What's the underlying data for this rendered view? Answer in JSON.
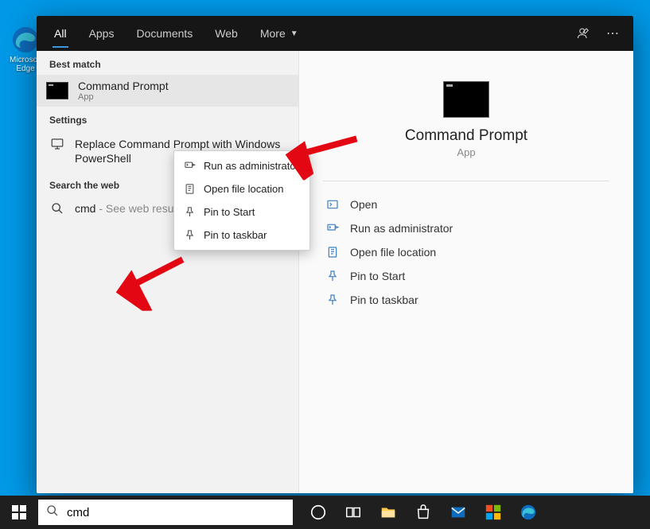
{
  "desktop": {
    "edge_label": "Microsoft Edge"
  },
  "tabs": {
    "all": "All",
    "apps": "Apps",
    "documents": "Documents",
    "web": "Web",
    "more": "More"
  },
  "left": {
    "best_match": "Best match",
    "settings": "Settings",
    "search_web": "Search the web",
    "result": {
      "title": "Command Prompt",
      "subtitle": "App"
    },
    "setting_item": "Replace Command Prompt with Windows PowerShell",
    "web_item_query": "cmd",
    "web_item_suffix": " - See web results"
  },
  "context_menu": {
    "run_admin": "Run as administrator",
    "open_location": "Open file location",
    "pin_start": "Pin to Start",
    "pin_taskbar": "Pin to taskbar"
  },
  "preview": {
    "title": "Command Prompt",
    "subtitle": "App",
    "actions": {
      "open": "Open",
      "run_admin": "Run as administrator",
      "open_location": "Open file location",
      "pin_start": "Pin to Start",
      "pin_taskbar": "Pin to taskbar"
    }
  },
  "search": {
    "value": "cmd"
  }
}
